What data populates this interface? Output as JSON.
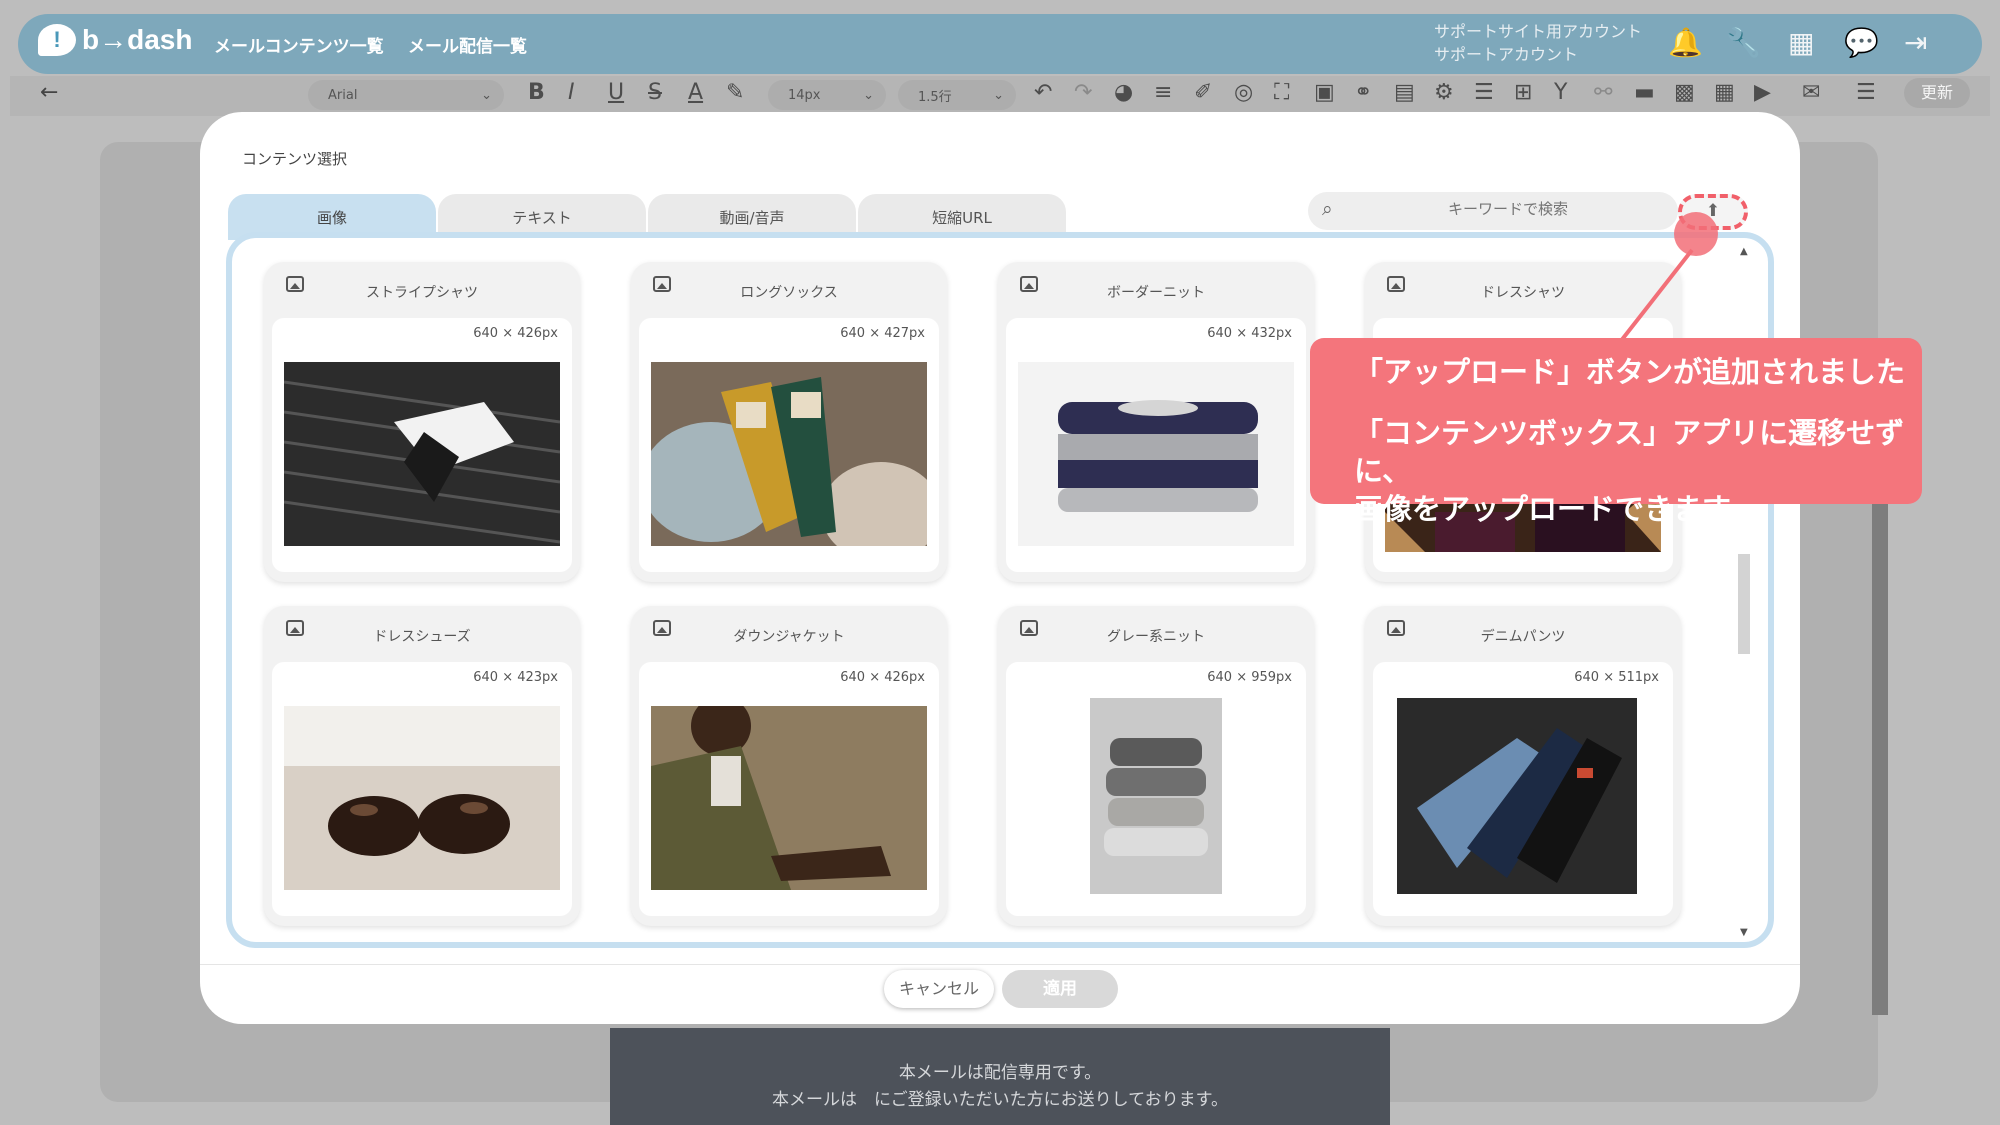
{
  "app": {
    "logo_text": "b→dash",
    "nav": [
      "メールコンテンツ一覧",
      "メール配信一覧"
    ],
    "account_line1": "サポートサイト用アカウント",
    "account_line2": "サポートアカウント"
  },
  "toolbar": {
    "font": "Arial",
    "font_size": "14px",
    "line_height": "1.5行",
    "update_label": "更新"
  },
  "modal": {
    "title": "コンテンツ選択",
    "tabs": [
      "画像",
      "テキスト",
      "動画/音声",
      "短縮URL"
    ],
    "active_tab": "画像",
    "search_placeholder": "キーワードで検索",
    "items": [
      {
        "name": "ストライプシャツ",
        "dims": "640 × 426px"
      },
      {
        "name": "ロングソックス",
        "dims": "640 × 427px"
      },
      {
        "name": "ボーダーニット",
        "dims": "640 × 432px"
      },
      {
        "name": "ドレスシャツ",
        "dims": ""
      },
      {
        "name": "ドレスシューズ",
        "dims": "640 × 423px"
      },
      {
        "name": "ダウンジャケット",
        "dims": "640 × 426px"
      },
      {
        "name": "グレー系ニット",
        "dims": "640 × 959px"
      },
      {
        "name": "デニムパンツ",
        "dims": "640 × 511px"
      }
    ],
    "cancel_label": "キャンセル",
    "apply_label": "適用"
  },
  "callout": {
    "line1": "「アップロード」ボタンが追加されました",
    "line2": "「コンテンツボックス」アプリに遷移せずに、",
    "line3": "画像をアップロードできます"
  },
  "background": {
    "footer_line1": "本メールは配信専用です。",
    "footer_line2": "本メールは　にご登録いただいた方にお送りしております。"
  },
  "colors": {
    "nav_bg": "#4a98b9",
    "tab_active": "#c8e0f0",
    "callout": "#f4757c",
    "upload_border": "#f1606a"
  }
}
